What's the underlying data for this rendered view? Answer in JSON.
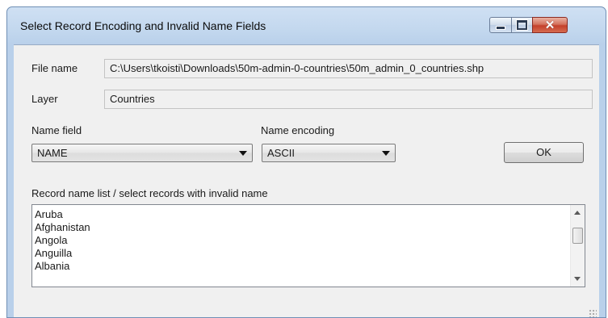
{
  "window": {
    "title": "Select Record Encoding and Invalid Name Fields",
    "controls": {
      "minimize_icon": "minimize-icon",
      "maximize_icon": "maximize-icon",
      "close_icon": "close-icon",
      "close_glyph": "✕"
    }
  },
  "file": {
    "label": "File name",
    "value": "C:\\Users\\tkoisti\\Downloads\\50m-admin-0-countries\\50m_admin_0_countries.shp"
  },
  "layer": {
    "label": "Layer",
    "value": "Countries"
  },
  "name_field": {
    "label": "Name field",
    "selected": "NAME"
  },
  "name_encoding": {
    "label": "Name encoding",
    "selected": "ASCII"
  },
  "ok_button": {
    "label": "OK"
  },
  "record_list": {
    "label": "Record name list / select records with invalid name",
    "items": [
      "Aruba",
      "Afghanistan",
      "Angola",
      "Anguilla",
      "Albania"
    ]
  },
  "colors": {
    "title_bar": "#c2d7ee",
    "close_button": "#c4402b",
    "client_bg": "#f0f0f0"
  }
}
